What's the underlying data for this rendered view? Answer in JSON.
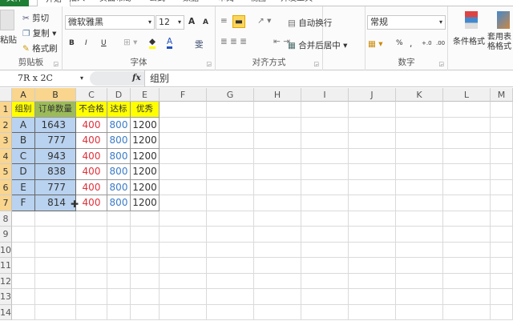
{
  "tabs": [
    "文件",
    "开始",
    "插入",
    "页面布局",
    "公式",
    "数据",
    "审阅",
    "视图",
    "开发工具"
  ],
  "ribbon": {
    "clipboard": {
      "paste": "粘贴",
      "cut": "剪切",
      "copy": "复制",
      "format_painter": "格式刷",
      "label": "剪贴板"
    },
    "font": {
      "name": "微软雅黑",
      "size": "12",
      "grow": "A",
      "shrink": "A",
      "bold": "B",
      "italic": "I",
      "underline": "U",
      "font_color": "A",
      "phonetic": "雯",
      "label": "字体"
    },
    "alignment": {
      "wrap": "自动换行",
      "merge": "合并后居中",
      "label": "对齐方式"
    },
    "number": {
      "format": "常规",
      "percent": "%",
      "comma": ",",
      "inc_decimal": "+.0",
      "dec_decimal": ".00",
      "label": "数字"
    },
    "styles": {
      "conditional": "条件格式",
      "table_format": "套用表格格式"
    }
  },
  "formula_bar": {
    "name_box": "7R x 2C",
    "fx": "fx",
    "content": "组别"
  },
  "columns": [
    "A",
    "B",
    "C",
    "D",
    "E",
    "F",
    "G",
    "H",
    "I",
    "J",
    "K",
    "L",
    "M"
  ],
  "rows": [
    "1",
    "2",
    "3",
    "4",
    "5",
    "6",
    "7",
    "8",
    "9",
    "10",
    "11",
    "12",
    "13",
    "14"
  ],
  "table": {
    "headers": [
      "组别",
      "订单数量",
      "不合格",
      "达标",
      "优秀"
    ],
    "rows": [
      [
        "A",
        "1643",
        "400",
        "800",
        "1200"
      ],
      [
        "B",
        "777",
        "400",
        "800",
        "1200"
      ],
      [
        "C",
        "943",
        "400",
        "800",
        "1200"
      ],
      [
        "D",
        "838",
        "400",
        "800",
        "1200"
      ],
      [
        "E",
        "777",
        "400",
        "800",
        "1200"
      ],
      [
        "F",
        "814",
        "400",
        "800",
        "1200"
      ]
    ]
  },
  "colors": {
    "header_yellow": "#ffff00",
    "header_green": "#9bbb59",
    "selection": "#b8d2ef",
    "fail_red": "#e0303a",
    "pass_blue": "#3a7bc8",
    "file_tab": "#1e7e34"
  }
}
